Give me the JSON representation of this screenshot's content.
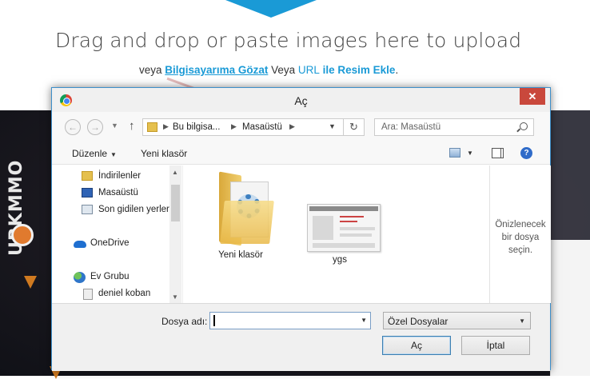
{
  "page": {
    "upload_title": "Drag and drop or paste images here to upload",
    "sub_or1": "veya ",
    "sub_browse": "Bilgisayarıma Gözat",
    "sub_or2": " Veya ",
    "sub_url": "URL",
    "sub_add": " ile Resim Ekle",
    "sub_end": ".",
    "brand": "URKMMO"
  },
  "dialog": {
    "title": "Aç",
    "close_glyph": "✕",
    "address": {
      "segment1": "Bu bilgisa...",
      "segment2": "Masaüstü"
    },
    "search_placeholder": "Ara: Masaüstü",
    "toolbar": {
      "organize": "Düzenle",
      "new_folder": "Yeni klasör"
    },
    "nav_items": [
      {
        "label": "İndirilenler",
        "icon": "downloads-folder-icon"
      },
      {
        "label": "Masaüstü",
        "icon": "desktop-icon"
      },
      {
        "label": "Son gidilen yerler",
        "icon": "recent-places-icon"
      },
      {
        "label": "OneDrive",
        "icon": "onedrive-cloud-icon"
      },
      {
        "label": "Ev Grubu",
        "icon": "homegroup-icon"
      },
      {
        "label": "deniel koban",
        "icon": "user-icon"
      }
    ],
    "files": [
      {
        "label": "Yeni klasör",
        "icon": "folder-icon"
      },
      {
        "label": "ygs",
        "icon": "image-thumbnail-icon"
      }
    ],
    "preview_text_1": "Önizlenecek",
    "preview_text_2": "bir dosya",
    "preview_text_3": "seçin.",
    "filename_label": "Dosya adı:",
    "filename_value": "",
    "filetype_value": "Özel Dosyalar",
    "open_button": "Aç",
    "cancel_button": "İptal"
  },
  "colors": {
    "accent": "#1a9ad6",
    "close": "#c9483c",
    "folder": "#e5c04e"
  }
}
